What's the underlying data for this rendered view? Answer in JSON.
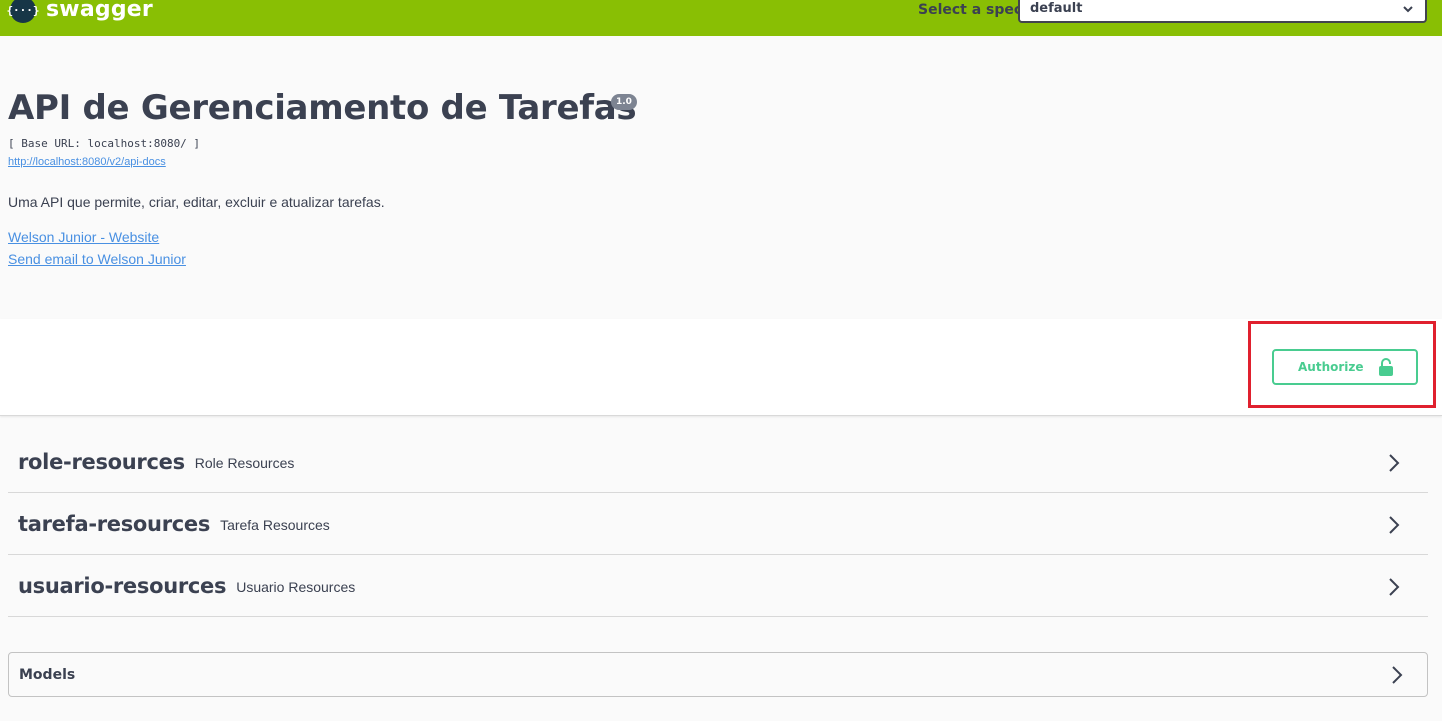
{
  "topbar": {
    "logo_glyph": "{···}",
    "brand": "swagger",
    "spec_label": "Select a spec",
    "spec_selected": "default"
  },
  "info": {
    "title": "API de Gerenciamento de Tarefas",
    "version": "1.0",
    "base_url": "[ Base URL: localhost:8080/ ]",
    "api_docs_link": "http://localhost:8080/v2/api-docs",
    "description": "Uma API que permite, criar, editar, excluir e atualizar tarefas.",
    "website_link": "Welson Junior - Website",
    "email_link": "Send email to Welson Junior"
  },
  "scheme": {
    "authorize_label": "Authorize"
  },
  "tags": [
    {
      "name": "role-resources",
      "description": "Role Resources"
    },
    {
      "name": "tarefa-resources",
      "description": "Tarefa Resources"
    },
    {
      "name": "usuario-resources",
      "description": "Usuario Resources"
    }
  ],
  "models": {
    "title": "Models"
  },
  "colors": {
    "topbar": "#89bf04",
    "authorize": "#49cc90",
    "link": "#4990e2",
    "highlight": "#e0202e"
  }
}
